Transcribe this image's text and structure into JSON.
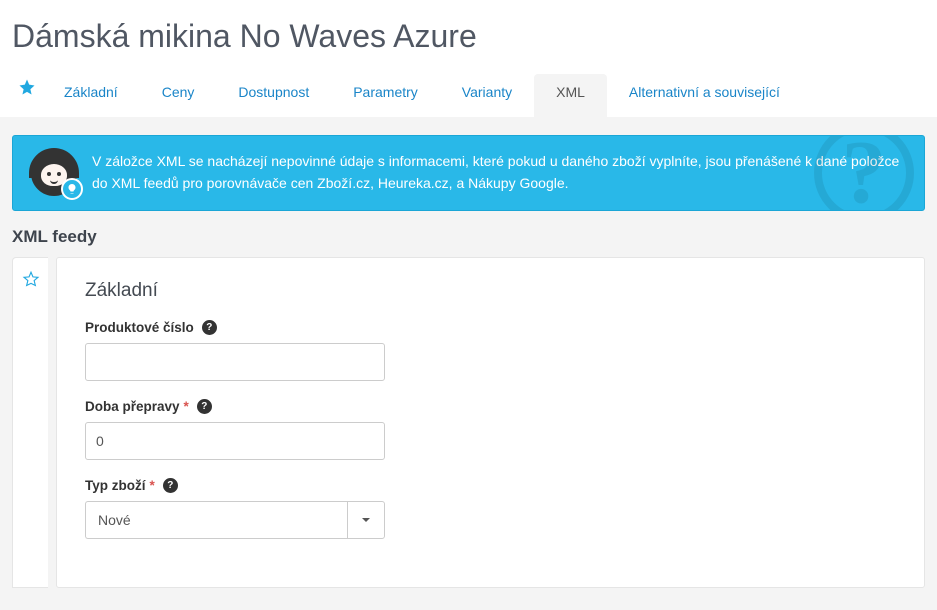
{
  "header": {
    "title": "Dámská mikina No Waves Azure"
  },
  "tabs": {
    "items": [
      {
        "label": "Základní"
      },
      {
        "label": "Ceny"
      },
      {
        "label": "Dostupnost"
      },
      {
        "label": "Parametry"
      },
      {
        "label": "Varianty"
      },
      {
        "label": "XML"
      },
      {
        "label": "Alternativní a související"
      }
    ],
    "active_index": 5
  },
  "banner": {
    "text": "V záložce XML se nacházejí nepovinné údaje s informacemi, které pokud u daného zboží vyplníte, jsou přenášené k dané položce do XML feedů pro porovnávače cen Zboží.cz, Heureka.cz, a Nákupy Google."
  },
  "section": {
    "heading": "XML feedy"
  },
  "form": {
    "group_title": "Základní",
    "fields": {
      "product_number": {
        "label": "Produktové číslo",
        "required": false,
        "value": ""
      },
      "delivery_time": {
        "label": "Doba přepravy",
        "required": true,
        "value": "0"
      },
      "goods_type": {
        "label": "Typ zboží",
        "required": true,
        "value": "Nové"
      }
    }
  },
  "glyphs": {
    "required": "*",
    "help": "?"
  }
}
